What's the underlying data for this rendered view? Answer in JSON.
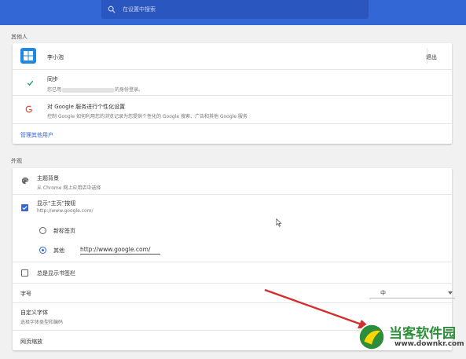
{
  "header": {
    "search_placeholder": "在设置中搜索"
  },
  "people": {
    "section_title": "其他人",
    "user_name": "李小泡",
    "signout_label": "退出",
    "sync_title": "同步",
    "sync_desc_prefix": "您已用",
    "sync_desc_suffix": "的身份登录。",
    "google_title": "对 Google 服务进行个性化设置",
    "google_desc": "控制 Google 如何利用您的浏览记录为您提供个性化的 Google 搜索、广告和其他 Google 服务",
    "manage_link": "管理其他用户"
  },
  "appearance": {
    "section_title": "外观",
    "theme_title": "主题背景",
    "theme_desc": "从 Chrome 网上应用店中选择",
    "show_home_title": "显示“主页”按钮",
    "show_home_desc": "http://www.google.com/",
    "show_home_checked": true,
    "newtab_label": "新标签页",
    "other_label": "其他",
    "other_url": "http://www.google.com/",
    "selected_home_option": "其他",
    "bookmarks_label": "总是显示书签栏",
    "bookmarks_checked": false,
    "fontsize_label": "字号",
    "fontsize_value": "中",
    "custom_font_title": "自定义字体",
    "custom_font_desc": "选择字体类型和编码",
    "zoom_label": "网页缩放"
  },
  "watermark": {
    "title": "当客软件园",
    "url": "www.downkr.com"
  },
  "colors": {
    "accent": "#3367d6",
    "arrow": "#d32f2f",
    "watermark_green": "#2d8e3a"
  }
}
